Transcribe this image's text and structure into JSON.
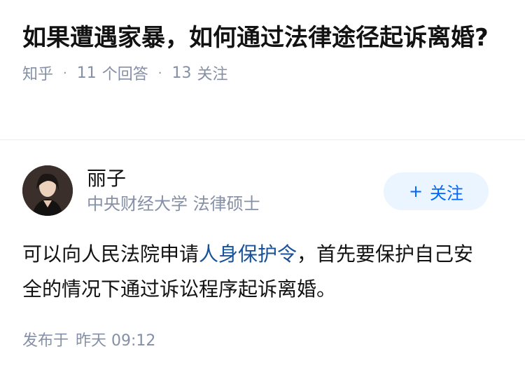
{
  "question": {
    "title": "如果遭遇家暴，如何通过法律途径起诉离婚?",
    "source": "知乎",
    "answers_count": "11",
    "answers_label": "个回答",
    "followers_count": "13",
    "followers_label": "关注"
  },
  "answer": {
    "author": {
      "name": "丽子",
      "bio": "中央财经大学 法律硕士",
      "follow_icon": "+",
      "follow_label": "关注"
    },
    "content": {
      "before_link": "可以向人民法院申请",
      "link_text": "人身保护令",
      "after_link": "，首先要保护自己安全的情况下通过诉讼程序起诉离婚。"
    },
    "published_label": "发布于",
    "published_time": "昨天 09:12"
  },
  "colors": {
    "accent": "#0066ff",
    "link": "#175199",
    "meta": "#8590a6",
    "follow_bg": "#ebf5ff"
  }
}
